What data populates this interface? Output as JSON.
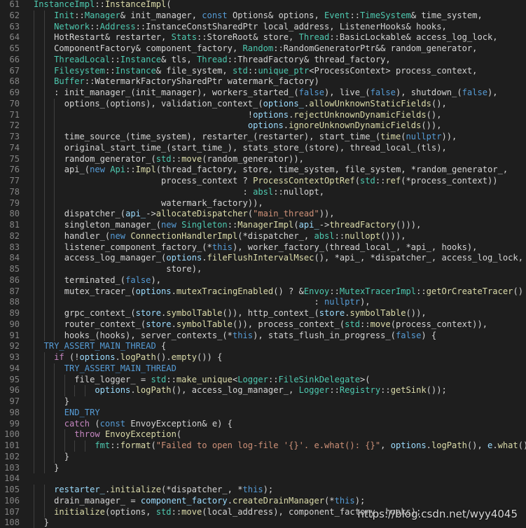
{
  "watermark": "https://blog.csdn.net/wyy4045",
  "colors": {
    "background": "#1e1e1e",
    "line_number": "#858585",
    "type": "#4ec9b0",
    "keyword": "#569cd6",
    "control": "#c586c0",
    "function": "#dcdcaa",
    "variable": "#9cdcfe",
    "string": "#ce9178",
    "plain": "#d4d4d4"
  },
  "lines": [
    {
      "n": "61",
      "indent": 0,
      "toks": [
        [
          "InstanceImpl",
          "type"
        ],
        [
          "::",
          "plain"
        ],
        [
          "InstanceImpl",
          "fn"
        ],
        [
          "(",
          "plain"
        ]
      ]
    },
    {
      "n": "62",
      "indent": 2,
      "toks": [
        [
          "Init",
          "type"
        ],
        [
          "::",
          "plain"
        ],
        [
          "Manager",
          "type"
        ],
        [
          "& init_manager, ",
          "plain"
        ],
        [
          "const",
          "kw"
        ],
        [
          " Options& options, ",
          "plain"
        ],
        [
          "Event",
          "type"
        ],
        [
          "::",
          "plain"
        ],
        [
          "TimeSystem",
          "type"
        ],
        [
          "& time_system,",
          "plain"
        ]
      ]
    },
    {
      "n": "63",
      "indent": 2,
      "toks": [
        [
          "Network",
          "type"
        ],
        [
          "::",
          "plain"
        ],
        [
          "Address",
          "type"
        ],
        [
          "::InstanceConstSharedPtr local_address, ListenerHooks& hooks,",
          "plain"
        ]
      ]
    },
    {
      "n": "64",
      "indent": 2,
      "toks": [
        [
          "HotRestart& restarter, ",
          "plain"
        ],
        [
          "Stats",
          "type"
        ],
        [
          "::StoreRoot& store, ",
          "plain"
        ],
        [
          "Thread",
          "type"
        ],
        [
          "::BasicLockable& access_log_lock,",
          "plain"
        ]
      ]
    },
    {
      "n": "65",
      "indent": 2,
      "toks": [
        [
          "ComponentFactory& component_factory, ",
          "plain"
        ],
        [
          "Random",
          "type"
        ],
        [
          "::RandomGeneratorPtr&& random_generator,",
          "plain"
        ]
      ]
    },
    {
      "n": "66",
      "indent": 2,
      "toks": [
        [
          "ThreadLocal",
          "type"
        ],
        [
          "::",
          "plain"
        ],
        [
          "Instance",
          "type"
        ],
        [
          "& tls, ",
          "plain"
        ],
        [
          "Thread",
          "type"
        ],
        [
          "::ThreadFactory& thread_factory,",
          "plain"
        ]
      ]
    },
    {
      "n": "67",
      "indent": 2,
      "toks": [
        [
          "Filesystem",
          "type"
        ],
        [
          "::",
          "plain"
        ],
        [
          "Instance",
          "type"
        ],
        [
          "& file_system, ",
          "plain"
        ],
        [
          "std",
          "type"
        ],
        [
          "::",
          "plain"
        ],
        [
          "unique_ptr",
          "type"
        ],
        [
          "<ProcessContext> process_context,",
          "plain"
        ]
      ]
    },
    {
      "n": "68",
      "indent": 2,
      "toks": [
        [
          "Buffer",
          "type"
        ],
        [
          "::WatermarkFactorySharedPtr watermark_factory)",
          "plain"
        ]
      ]
    },
    {
      "n": "69",
      "indent": 2,
      "toks": [
        [
          ": init_manager_(init_manager), workers_started_(",
          "plain"
        ],
        [
          "false",
          "kw"
        ],
        [
          "), live_(",
          "plain"
        ],
        [
          "false",
          "kw"
        ],
        [
          "), shutdown_(",
          "plain"
        ],
        [
          "false",
          "kw"
        ],
        [
          "),",
          "plain"
        ]
      ]
    },
    {
      "n": "70",
      "indent": 3,
      "toks": [
        [
          "options_(options), validation_context_(",
          "plain"
        ],
        [
          "options_",
          "var"
        ],
        [
          ".",
          "plain"
        ],
        [
          "allowUnknownStaticFields",
          "fn"
        ],
        [
          "(),",
          "plain"
        ]
      ]
    },
    {
      "n": "71",
      "indent": 3,
      "toks": [
        [
          "                                    !",
          "plain"
        ],
        [
          "options",
          "var"
        ],
        [
          ".",
          "plain"
        ],
        [
          "rejectUnknownDynamicFields",
          "fn"
        ],
        [
          "(),",
          "plain"
        ]
      ]
    },
    {
      "n": "72",
      "indent": 3,
      "toks": [
        [
          "                                    ",
          "plain"
        ],
        [
          "options",
          "var"
        ],
        [
          ".",
          "plain"
        ],
        [
          "ignoreUnknownDynamicFields",
          "fn"
        ],
        [
          "()),",
          "plain"
        ]
      ]
    },
    {
      "n": "73",
      "indent": 3,
      "toks": [
        [
          "time_source_(time_system), restarter_(restarter), start_time_(",
          "plain"
        ],
        [
          "time",
          "fn"
        ],
        [
          "(",
          "plain"
        ],
        [
          "nullptr",
          "kw"
        ],
        [
          ")),",
          "plain"
        ]
      ]
    },
    {
      "n": "74",
      "indent": 3,
      "toks": [
        [
          "original_start_time_(start_time_), stats_store_(store), thread_local_(tls),",
          "plain"
        ]
      ]
    },
    {
      "n": "75",
      "indent": 3,
      "toks": [
        [
          "random_generator_(",
          "plain"
        ],
        [
          "std",
          "type"
        ],
        [
          "::",
          "plain"
        ],
        [
          "move",
          "fn"
        ],
        [
          "(random_generator)),",
          "plain"
        ]
      ]
    },
    {
      "n": "76",
      "indent": 3,
      "toks": [
        [
          "api_(",
          "plain"
        ],
        [
          "new",
          "kw"
        ],
        [
          " ",
          "plain"
        ],
        [
          "Api",
          "type"
        ],
        [
          "::",
          "plain"
        ],
        [
          "Impl",
          "fn"
        ],
        [
          "(thread_factory, store, time_system, file_system, *random_generator_,",
          "plain"
        ]
      ]
    },
    {
      "n": "77",
      "indent": 3,
      "toks": [
        [
          "                   process_context ? ",
          "plain"
        ],
        [
          "ProcessContextOptRef",
          "fn"
        ],
        [
          "(",
          "plain"
        ],
        [
          "std",
          "type"
        ],
        [
          "::",
          "plain"
        ],
        [
          "ref",
          "fn"
        ],
        [
          "(*process_context))",
          "plain"
        ]
      ]
    },
    {
      "n": "78",
      "indent": 3,
      "toks": [
        [
          "                                   : ",
          "plain"
        ],
        [
          "absl",
          "type"
        ],
        [
          "::nullopt,",
          "plain"
        ]
      ]
    },
    {
      "n": "79",
      "indent": 3,
      "toks": [
        [
          "                   watermark_factory)),",
          "plain"
        ]
      ]
    },
    {
      "n": "80",
      "indent": 3,
      "toks": [
        [
          "dispatcher_(",
          "plain"
        ],
        [
          "api_",
          "var"
        ],
        [
          "->",
          "plain"
        ],
        [
          "allocateDispatcher",
          "fn"
        ],
        [
          "(",
          "plain"
        ],
        [
          "\"main_thread\"",
          "str"
        ],
        [
          ")),",
          "plain"
        ]
      ]
    },
    {
      "n": "81",
      "indent": 3,
      "toks": [
        [
          "singleton_manager_(",
          "plain"
        ],
        [
          "new",
          "kw"
        ],
        [
          " ",
          "plain"
        ],
        [
          "Singleton",
          "type"
        ],
        [
          "::",
          "plain"
        ],
        [
          "ManagerImpl",
          "fn"
        ],
        [
          "(",
          "plain"
        ],
        [
          "api_",
          "var"
        ],
        [
          "->",
          "plain"
        ],
        [
          "threadFactory",
          "fn"
        ],
        [
          "())),",
          "plain"
        ]
      ]
    },
    {
      "n": "82",
      "indent": 3,
      "toks": [
        [
          "handler_(",
          "plain"
        ],
        [
          "new",
          "kw"
        ],
        [
          " ",
          "plain"
        ],
        [
          "ConnectionHandlerImpl",
          "fn"
        ],
        [
          "(*dispatcher_, ",
          "plain"
        ],
        [
          "absl",
          "type"
        ],
        [
          "::",
          "plain"
        ],
        [
          "nullopt",
          "fn"
        ],
        [
          "())),",
          "plain"
        ]
      ]
    },
    {
      "n": "83",
      "indent": 3,
      "toks": [
        [
          "listener_component_factory_(*",
          "plain"
        ],
        [
          "this",
          "kw"
        ],
        [
          "), worker_factory_(thread_local_, *api_, hooks),",
          "plain"
        ]
      ]
    },
    {
      "n": "84",
      "indent": 3,
      "toks": [
        [
          "access_log_manager_(",
          "plain"
        ],
        [
          "options",
          "var"
        ],
        [
          ".",
          "plain"
        ],
        [
          "fileFlushIntervalMsec",
          "fn"
        ],
        [
          "(), *api_, *dispatcher_, access_log_lock,",
          "plain"
        ]
      ]
    },
    {
      "n": "85",
      "indent": 3,
      "toks": [
        [
          "                    store),",
          "plain"
        ]
      ]
    },
    {
      "n": "86",
      "indent": 3,
      "toks": [
        [
          "terminated_(",
          "plain"
        ],
        [
          "false",
          "kw"
        ],
        [
          "),",
          "plain"
        ]
      ]
    },
    {
      "n": "87",
      "indent": 3,
      "toks": [
        [
          "mutex_tracer_(",
          "plain"
        ],
        [
          "options",
          "var"
        ],
        [
          ".",
          "plain"
        ],
        [
          "mutexTracingEnabled",
          "fn"
        ],
        [
          "() ? &",
          "plain"
        ],
        [
          "Envoy",
          "type"
        ],
        [
          "::",
          "plain"
        ],
        [
          "MutexTracerImpl",
          "type"
        ],
        [
          "::",
          "plain"
        ],
        [
          "getOrCreateTracer",
          "fn"
        ],
        [
          "()",
          "plain"
        ]
      ]
    },
    {
      "n": "88",
      "indent": 3,
      "toks": [
        [
          "                                                 : ",
          "plain"
        ],
        [
          "nullptr",
          "kw"
        ],
        [
          "),",
          "plain"
        ]
      ]
    },
    {
      "n": "89",
      "indent": 3,
      "toks": [
        [
          "grpc_context_(",
          "plain"
        ],
        [
          "store",
          "var"
        ],
        [
          ".",
          "plain"
        ],
        [
          "symbolTable",
          "fn"
        ],
        [
          "()), http_context_(",
          "plain"
        ],
        [
          "store",
          "var"
        ],
        [
          ".",
          "plain"
        ],
        [
          "symbolTable",
          "fn"
        ],
        [
          "()),",
          "plain"
        ]
      ]
    },
    {
      "n": "90",
      "indent": 3,
      "toks": [
        [
          "router_context_(",
          "plain"
        ],
        [
          "store",
          "var"
        ],
        [
          ".",
          "plain"
        ],
        [
          "symbolTable",
          "fn"
        ],
        [
          "()), process_context_(",
          "plain"
        ],
        [
          "std",
          "type"
        ],
        [
          "::",
          "plain"
        ],
        [
          "move",
          "fn"
        ],
        [
          "(process_context)),",
          "plain"
        ]
      ]
    },
    {
      "n": "91",
      "indent": 3,
      "toks": [
        [
          "hooks_(hooks), server_contexts_(*",
          "plain"
        ],
        [
          "this",
          "kw"
        ],
        [
          "), stats_flush_in_progress_(",
          "plain"
        ],
        [
          "false",
          "kw"
        ],
        [
          ") {",
          "plain"
        ]
      ]
    },
    {
      "n": "92",
      "indent": 1,
      "toks": [
        [
          "TRY_ASSERT_MAIN_THREAD",
          "kw"
        ],
        [
          " {",
          "plain"
        ]
      ]
    },
    {
      "n": "93",
      "indent": 2,
      "toks": [
        [
          "if",
          "ctrl"
        ],
        [
          " (!",
          "plain"
        ],
        [
          "options",
          "var"
        ],
        [
          ".",
          "plain"
        ],
        [
          "logPath",
          "fn"
        ],
        [
          "().",
          "plain"
        ],
        [
          "empty",
          "fn"
        ],
        [
          "()) {",
          "plain"
        ]
      ]
    },
    {
      "n": "94",
      "indent": 3,
      "toks": [
        [
          "TRY_ASSERT_MAIN_THREAD",
          "kw"
        ]
      ]
    },
    {
      "n": "95",
      "indent": 4,
      "toks": [
        [
          "file_logger_ = ",
          "plain"
        ],
        [
          "std",
          "type"
        ],
        [
          "::",
          "plain"
        ],
        [
          "make_unique",
          "fn"
        ],
        [
          "<",
          "plain"
        ],
        [
          "Logger",
          "type"
        ],
        [
          "::",
          "plain"
        ],
        [
          "FileSinkDelegate",
          "type"
        ],
        [
          ">(",
          "plain"
        ]
      ]
    },
    {
      "n": "96",
      "indent": 6,
      "toks": [
        [
          "options",
          "var"
        ],
        [
          ".",
          "plain"
        ],
        [
          "logPath",
          "fn"
        ],
        [
          "(), access_log_manager_, ",
          "plain"
        ],
        [
          "Logger",
          "type"
        ],
        [
          "::",
          "plain"
        ],
        [
          "Registry",
          "type"
        ],
        [
          "::",
          "plain"
        ],
        [
          "getSink",
          "fn"
        ],
        [
          "());",
          "plain"
        ]
      ]
    },
    {
      "n": "97",
      "indent": 3,
      "toks": [
        [
          "}",
          "plain"
        ]
      ]
    },
    {
      "n": "98",
      "indent": 3,
      "toks": [
        [
          "END_TRY",
          "kw"
        ]
      ]
    },
    {
      "n": "99",
      "indent": 3,
      "toks": [
        [
          "catch",
          "ctrl"
        ],
        [
          " (",
          "plain"
        ],
        [
          "const",
          "kw"
        ],
        [
          " EnvoyException& e) {",
          "plain"
        ]
      ]
    },
    {
      "n": "100",
      "indent": 4,
      "toks": [
        [
          "throw",
          "ctrl"
        ],
        [
          " ",
          "plain"
        ],
        [
          "EnvoyException",
          "fn"
        ],
        [
          "(",
          "plain"
        ]
      ]
    },
    {
      "n": "101",
      "indent": 6,
      "toks": [
        [
          "fmt",
          "type"
        ],
        [
          "::",
          "plain"
        ],
        [
          "format",
          "fn"
        ],
        [
          "(",
          "plain"
        ],
        [
          "\"Failed to open log-file '{}'. e.what(): {}\"",
          "str"
        ],
        [
          ", ",
          "plain"
        ],
        [
          "options",
          "var"
        ],
        [
          ".",
          "plain"
        ],
        [
          "logPath",
          "fn"
        ],
        [
          "(), ",
          "plain"
        ],
        [
          "e",
          "var"
        ],
        [
          ".",
          "plain"
        ],
        [
          "what",
          "fn"
        ],
        [
          "()));",
          "plain"
        ]
      ]
    },
    {
      "n": "102",
      "indent": 3,
      "toks": [
        [
          "}",
          "plain"
        ]
      ]
    },
    {
      "n": "103",
      "indent": 2,
      "toks": [
        [
          "}",
          "plain"
        ]
      ]
    },
    {
      "n": "104",
      "indent": 0,
      "toks": []
    },
    {
      "n": "105",
      "indent": 2,
      "toks": [
        [
          "restarter_",
          "var"
        ],
        [
          ".",
          "plain"
        ],
        [
          "initialize",
          "fn"
        ],
        [
          "(*dispatcher_, *",
          "plain"
        ],
        [
          "this",
          "kw"
        ],
        [
          ");",
          "plain"
        ]
      ]
    },
    {
      "n": "106",
      "indent": 2,
      "toks": [
        [
          "drain_manager_ = ",
          "plain"
        ],
        [
          "component_factory",
          "var"
        ],
        [
          ".",
          "plain"
        ],
        [
          "createDrainManager",
          "fn"
        ],
        [
          "(*",
          "plain"
        ],
        [
          "this",
          "kw"
        ],
        [
          ");",
          "plain"
        ]
      ]
    },
    {
      "n": "107",
      "indent": 2,
      "toks": [
        [
          "initialize",
          "fn"
        ],
        [
          "(options, ",
          "plain"
        ],
        [
          "std",
          "type"
        ],
        [
          "::",
          "plain"
        ],
        [
          "move",
          "fn"
        ],
        [
          "(local_address), component_factory, hooks);",
          "plain"
        ]
      ]
    },
    {
      "n": "108",
      "indent": 1,
      "toks": [
        [
          "}",
          "plain"
        ]
      ]
    }
  ]
}
